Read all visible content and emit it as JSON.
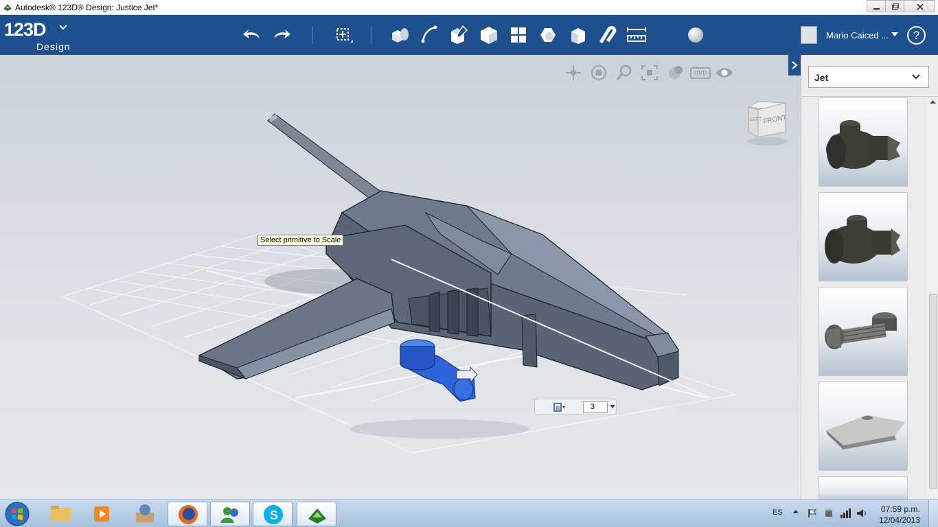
{
  "window": {
    "title": "Autodesk® 123D® Design: Justice Jet*"
  },
  "header": {
    "logo_main": "123D",
    "logo_sub": "Design",
    "user_name": "Mario Caiced ...",
    "help_label": "?"
  },
  "toolbar": {
    "icons": [
      "undo-icon",
      "redo-icon",
      "transform-icon",
      "primitives-icon",
      "sketch-icon",
      "construct-icon",
      "modify-icon",
      "pattern-icon",
      "grouping-icon",
      "combine-icon",
      "snap-icon",
      "measure-icon",
      "material-icon"
    ]
  },
  "viewport": {
    "nav_icons": [
      "pan-icon",
      "orbit-icon",
      "zoom-icon",
      "fit-icon",
      "view-settings-icon",
      "units-icon",
      "visibility-icon"
    ],
    "units_label": "mm",
    "viewcube_label": "FRONT",
    "viewcube_side_label": "LEFT",
    "tooltip": "Select primitive to Scale",
    "scale_value": "3"
  },
  "panel": {
    "category": "Jet",
    "thumbnails": [
      "jet-engine-part-1",
      "jet-engine-part-2",
      "jet-turbine-part",
      "jet-wing-part",
      "jet-part-5"
    ]
  },
  "taskbar": {
    "apps": [
      "file-explorer",
      "media-player",
      "archive-app",
      "firefox",
      "messenger",
      "skype",
      "123d-design"
    ],
    "language": "ES",
    "time": "07:59 p.m.",
    "date": "12/04/2013"
  },
  "colors": {
    "header": "#1e4f8f",
    "selection": "#2a5bd7",
    "model": "#5a6778"
  }
}
